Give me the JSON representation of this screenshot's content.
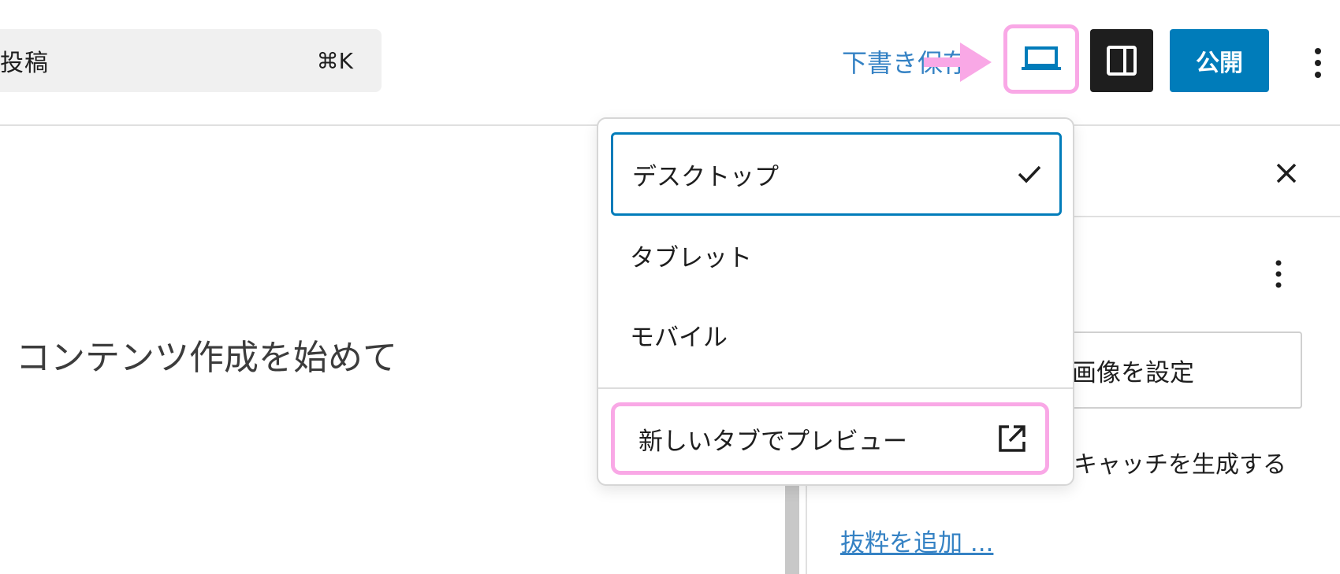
{
  "header": {
    "command_title": "投稿",
    "command_shortcut": "⌘K",
    "draft_save": "下書き保存",
    "publish": "公開"
  },
  "editor": {
    "placeholder": "コンテンツ作成を始めて"
  },
  "dropdown": {
    "items": [
      {
        "label": "デスクトップ",
        "selected": true
      },
      {
        "label": "タブレット",
        "selected": false
      },
      {
        "label": "モバイル",
        "selected": false
      }
    ],
    "preview_new_tab": "新しいタブでプレビュー"
  },
  "sidebar": {
    "featured_image_button": "画像を設定",
    "generate_eyecatch": "キャッチを生成する",
    "add_excerpt": "抜粋を追加 ..."
  },
  "colors": {
    "accent": "#007cba",
    "highlight": "#f9a8e6",
    "link": "#3582c4"
  }
}
